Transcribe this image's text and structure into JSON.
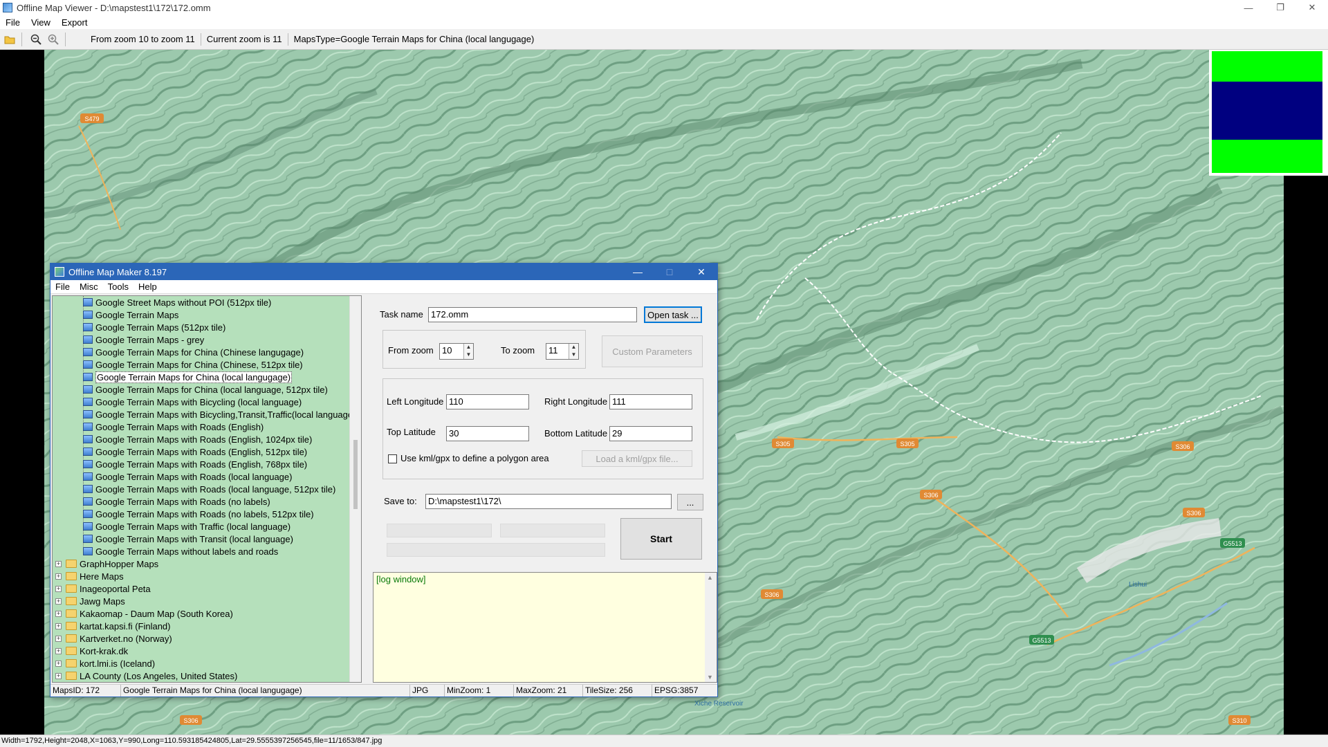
{
  "viewer": {
    "title": "Offline Map Viewer - D:\\mapstest1\\172\\172.omm",
    "menu": [
      "File",
      "View",
      "Export"
    ],
    "toolbar": {
      "zoom_range": "From zoom 10 to zoom 11",
      "current_zoom": "Current zoom is 11",
      "maps_type": "MapsType=Google Terrain Maps for China (local langugage)"
    },
    "status": "Width=1792,Height=2048,X=1063,Y=990,Long=110.593185424805,Lat=29.5555397256545,file=11/1653/847.jpg",
    "window_controls": [
      "minimize",
      "restore",
      "close"
    ]
  },
  "minimap_colors": {
    "top": "#00ff00",
    "middle": "#000080",
    "bottom": "#00ff00"
  },
  "map_labels": [
    {
      "text": "S479"
    },
    {
      "text": "S305"
    },
    {
      "text": "S306"
    },
    {
      "text": "G5513"
    },
    {
      "text": "S310"
    },
    {
      "text": "Xiche Reservoir"
    },
    {
      "text": "Lishui"
    }
  ],
  "dialog": {
    "title": "Offline Map Maker 8.197",
    "menu": [
      "File",
      "Misc",
      "Tools",
      "Help"
    ],
    "tree": {
      "leaves": [
        "Google Street Maps without POI (512px tile)",
        "Google Terrain Maps",
        "Google Terrain Maps (512px tile)",
        "Google Terrain Maps - grey",
        "Google Terrain Maps for China (Chinese langugage)",
        "Google Terrain Maps for China (Chinese, 512px tile)",
        "Google Terrain Maps for China (local langugage)",
        "Google Terrain Maps for China (local language, 512px tile)",
        "Google Terrain Maps with Bicycling (local language)",
        "Google Terrain Maps with Bicycling,Transit,Traffic(local language)",
        "Google Terrain Maps with Roads (English)",
        "Google Terrain Maps with Roads (English, 1024px tile)",
        "Google Terrain Maps with Roads (English, 512px tile)",
        "Google Terrain Maps with Roads (English, 768px tile)",
        "Google Terrain Maps with Roads (local language)",
        "Google Terrain Maps with Roads (local language, 512px tile)",
        "Google Terrain Maps with Roads (no labels)",
        "Google Terrain Maps with Roads (no labels, 512px tile)",
        "Google Terrain Maps with Traffic (local language)",
        "Google Terrain Maps with Transit (local language)",
        "Google Terrain Maps without labels and roads"
      ],
      "selected": "Google Terrain Maps for China (local langugage)",
      "folders": [
        "GraphHopper Maps",
        "Here Maps",
        "Inageoportal Peta",
        "Jawg Maps",
        "Kakaomap - Daum Map (South Korea)",
        "kartat.kapsi.fi (Finland)",
        "Kartverket.no (Norway)",
        "Kort-krak.dk",
        "kort.lmi.is (Iceland)",
        "LA County (Los Angeles, United States)"
      ]
    },
    "form": {
      "task_name_label": "Task name",
      "task_name_value": "172.omm",
      "open_task_label": "Open task ...",
      "from_zoom_label": "From zoom",
      "from_zoom_value": "10",
      "to_zoom_label": "To zoom",
      "to_zoom_value": "11",
      "custom_params_label": "Custom Parameters",
      "left_lon_label": "Left Longitude",
      "left_lon_value": "110",
      "right_lon_label": "Right Longitude",
      "right_lon_value": "111",
      "top_lat_label": "Top Latitude",
      "top_lat_value": "30",
      "bottom_lat_label": "Bottom Latitude",
      "bottom_lat_value": "29",
      "kml_checkbox_label": "Use kml/gpx to define a polygon area",
      "kml_checked": false,
      "load_kml_label": "Load a kml/gpx file...",
      "save_to_label": "Save to:",
      "save_to_value": "D:\\mapstest1\\172\\",
      "browse_label": "...",
      "start_label": "Start"
    },
    "log": "[log window]",
    "status": {
      "maps_id": "MapsID: 172",
      "maps_name": "Google Terrain Maps for China (local langugage)",
      "format": "JPG",
      "min_zoom": "MinZoom: 1",
      "max_zoom": "MaxZoom: 21",
      "tile_size": "TileSize: 256",
      "epsg": "EPSG:3857"
    }
  }
}
